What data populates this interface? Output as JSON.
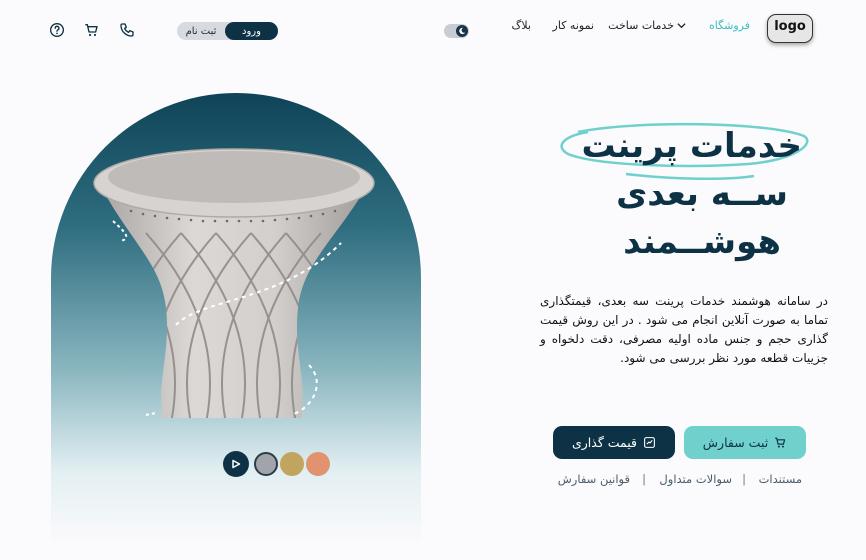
{
  "header": {
    "logo": "logo",
    "nav": {
      "shop": "فروشگاه",
      "services": "خدمات ساخت",
      "portfolio": "نمونه کار",
      "blog": "بلاگ"
    },
    "auth": {
      "login": "ورود",
      "register": "ثبت نام"
    },
    "icons": [
      "help-icon",
      "cart-icon",
      "phone-icon",
      "moon-icon"
    ]
  },
  "hero": {
    "title_line1": "خدمات پرینت",
    "title_line2": "ســه بعدی",
    "title_line3": "هوشــمند",
    "description": "در سامانه هوشمند خدمات پرینت سه بعدی، قیمتگذاری تماما به صورت آنلاین انجام می شود . در این روش قیمت گذاری حجم و جنس ماده اولیه مصرفی، دقت دلخواه و جزییات قطعه مورد نظر بررسی می شود.",
    "buttons": {
      "order": "ثبت سفارش",
      "pricing": "قیمت گذاری"
    },
    "links": {
      "docs": "مستندات",
      "faq": "سوالات متداول",
      "rules": "قوانین سفارش"
    }
  },
  "viewer": {
    "swatch_colors": [
      "#a1a4a8",
      "#c1a45e",
      "#e0936e"
    ],
    "selected_swatch": 0
  },
  "colors": {
    "primary": "#0d3245",
    "accent": "#6fd0cc",
    "active_nav": "#3dbfbf",
    "background": "#fbfafc"
  }
}
